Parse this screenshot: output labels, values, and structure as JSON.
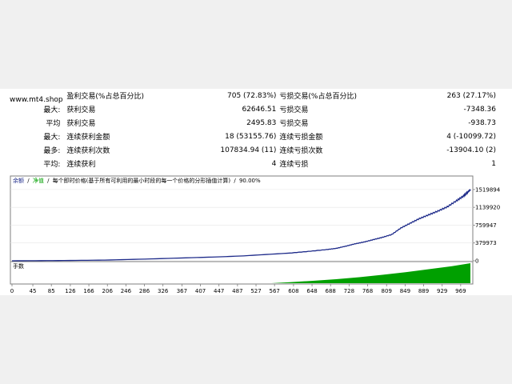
{
  "watermark": "www.mt4.shop",
  "stats": [
    {
      "label1": "",
      "label2": "盈利交易(%占总百分比)",
      "value1": "705 (72.83%)",
      "label3": "亏损交易(%占总百分比)",
      "value2": "263 (27.17%)"
    },
    {
      "label1": "最大:",
      "label2": "获利交易",
      "value1": "62646.51",
      "label3": "亏损交易",
      "value2": "-7348.36"
    },
    {
      "label1": "平均",
      "label2": "获利交易",
      "value1": "2495.83",
      "label3": "亏损交易",
      "value2": "-938.73"
    },
    {
      "label1": "最大:",
      "label2": "连续获利金额",
      "value1": "18 (53155.76)",
      "label3": "连续亏损金额",
      "value2": "4 (-10099.72)"
    },
    {
      "label1": "最多:",
      "label2": "连续获利次数",
      "value1": "107834.94 (11)",
      "label3": "连续亏损次数",
      "value2": "-13904.10 (2)"
    },
    {
      "label1": "平均:",
      "label2": "连续获利",
      "value1": "4",
      "label3": "连续亏损",
      "value2": "1"
    }
  ],
  "legend": {
    "balance": "余额",
    "sep1": "/",
    "equity": "净值",
    "sep2": "/",
    "model": "每个即时价格(基于所有可利用的最小时段的每一个价格的分形插值计算)",
    "sep3": "/",
    "quality": "90.00%"
  },
  "lot_label": "手数",
  "colors": {
    "balance": "#1e2b8a",
    "equity": "#1e2b8a",
    "volume": "#00a000",
    "border": "#7f7f7f"
  },
  "chart_data": {
    "type": "line",
    "x_ticks": [
      0,
      45,
      85,
      126,
      166,
      206,
      246,
      286,
      326,
      367,
      407,
      447,
      487,
      527,
      567,
      608,
      648,
      688,
      728,
      768,
      809,
      849,
      889,
      929,
      969
    ],
    "y_ticks": [
      0,
      379973,
      759947,
      1139920,
      1519894
    ],
    "ylim": [
      0,
      1620000
    ],
    "xlim": [
      0,
      990
    ],
    "series": [
      {
        "x": [
          0,
          100,
          200,
          300,
          400,
          450,
          500,
          550,
          600,
          640,
          680,
          700,
          720,
          740,
          760,
          780,
          800,
          820,
          840,
          860,
          880,
          900,
          920,
          940,
          960,
          975,
          985,
          990
        ],
        "values": [
          0,
          5000,
          15000,
          40000,
          70000,
          85000,
          105000,
          135000,
          165000,
          200000,
          240000,
          265000,
          310000,
          360000,
          400000,
          450000,
          500000,
          560000,
          700000,
          800000,
          900000,
          980000,
          1060000,
          1150000,
          1280000,
          1380000,
          1470000,
          1519894
        ]
      }
    ],
    "volume": {
      "x": [
        0,
        560,
        600,
        650,
        700,
        750,
        800,
        850,
        900,
        950,
        990
      ],
      "values": [
        0.0,
        0.0,
        0.05,
        0.12,
        0.2,
        0.3,
        0.42,
        0.55,
        0.7,
        0.85,
        1.0
      ]
    }
  }
}
